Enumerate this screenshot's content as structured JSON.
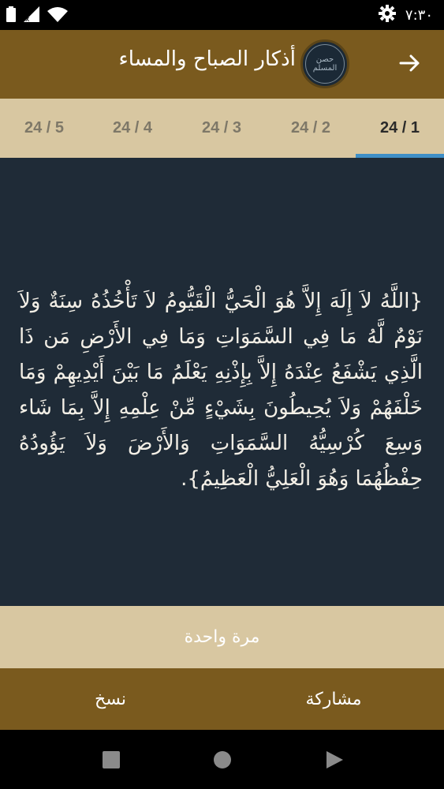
{
  "status_bar": {
    "time": "٧:٣٠",
    "icons": [
      "battery-icon",
      "signal-off-icon",
      "wifi-icon",
      "settings-gear-icon"
    ]
  },
  "app_bar": {
    "title": "أذكار الصباح والمساء",
    "logo_text": "حصن المسلم",
    "back_icon": "arrow-right-icon"
  },
  "tabs": [
    {
      "label": "24 / 5"
    },
    {
      "label": "24 / 4"
    },
    {
      "label": "24 / 3"
    },
    {
      "label": "24 / 2"
    },
    {
      "label": "24 / 1",
      "active": true
    }
  ],
  "content": {
    "text": "{اللَّهُ لاَ إِلَهَ إِلاَّ هُوَ الْحَيُّ الْقَيُّومُ لاَ تَأْخُذُهُ سِنَةٌ وَلاَ نَوْمٌ لَّهُ مَا فِي السَّمَوَاتِ وَمَا فِي الأَرْضِ مَن ذَا الَّذِي يَشْفَعُ عِنْدَهُ إِلاَّ بِإِذْنِهِ يَعْلَمُ مَا بَيْنَ أَيْدِيهِمْ وَمَا خَلْفَهُمْ وَلاَ يُحِيطُونَ بِشَيْءٍ مِّنْ عِلْمِهِ إِلاَّ بِمَا شَاء وَسِعَ كُرْسِيُّهُ السَّمَوَاتِ وَالأَرْضَ وَلاَ يَؤُودُهُ حِفْظُهُمَا وَهُوَ الْعَلِيُّ الْعَظِيمُ}."
  },
  "count": {
    "label": "مرة واحدة"
  },
  "actions": {
    "share_label": "مشاركة",
    "copy_label": "نسخ"
  },
  "colors": {
    "header": "#7a5a1e",
    "tabs_bg": "#d8c7a1",
    "content_bg": "#1f2b37",
    "indicator": "#3f8fc7"
  }
}
